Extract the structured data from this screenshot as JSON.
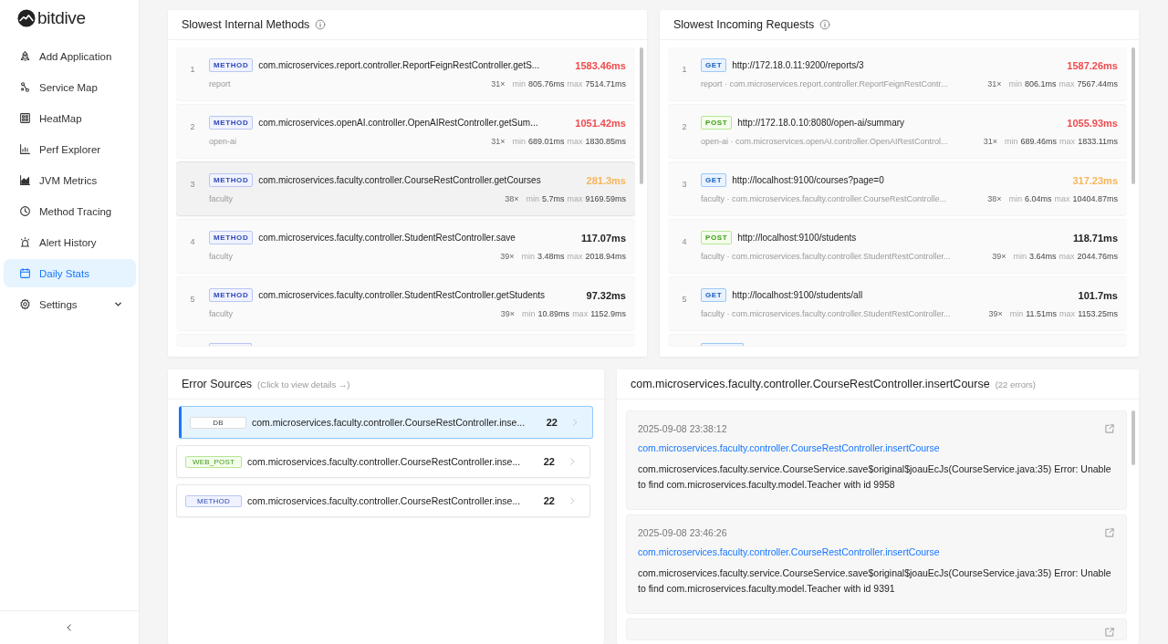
{
  "sidebar": {
    "logo": "bitdive",
    "items": [
      {
        "label": "Add Application",
        "kind": "rocket",
        "selected": false
      },
      {
        "label": "Service Map",
        "kind": "nodes",
        "selected": false
      },
      {
        "label": "HeatMap",
        "kind": "grid",
        "selected": false
      },
      {
        "label": "Perf Explorer",
        "kind": "bars",
        "selected": false
      },
      {
        "label": "JVM Metrics",
        "kind": "area",
        "selected": false
      },
      {
        "label": "Method Tracing",
        "kind": "clock",
        "selected": false
      },
      {
        "label": "Alert History",
        "kind": "alarm",
        "selected": false
      },
      {
        "label": "Daily Stats",
        "kind": "calendar",
        "selected": true
      },
      {
        "label": "Settings",
        "kind": "gear",
        "selected": false,
        "submenu": true
      }
    ]
  },
  "methods_panel": {
    "title": "Slowest Internal Methods",
    "rows": [
      {
        "rank": "1",
        "badge": "METHOD",
        "name": "com.microservices.report.controller.ReportFeignRestController.getS...",
        "service": "report",
        "time": "1583.46ms",
        "color": "#ef4b4f",
        "count": "31×",
        "min_label": "min",
        "min": "805.76ms",
        "max_label": "max",
        "max": "7514.71ms",
        "highlighted": false
      },
      {
        "rank": "2",
        "badge": "METHOD",
        "name": "com.microservices.openAI.controller.OpenAIRestController.getSum...",
        "service": "open-ai",
        "time": "1051.42ms",
        "color": "#ef4b4f",
        "count": "31×",
        "min_label": "min",
        "min": "689.01ms",
        "max_label": "max",
        "max": "1830.85ms",
        "highlighted": false
      },
      {
        "rank": "3",
        "badge": "METHOD",
        "name": "com.microservices.faculty.controller.CourseRestController.getCourses",
        "service": "faculty",
        "time": "281.3ms",
        "color": "#f6b55a",
        "count": "38×",
        "min_label": "min",
        "min": "5.7ms",
        "max_label": "max",
        "max": "9169.59ms",
        "highlighted": true
      },
      {
        "rank": "4",
        "badge": "METHOD",
        "name": "com.microservices.faculty.controller.StudentRestController.save",
        "service": "faculty",
        "time": "117.07ms",
        "color": "#222222",
        "count": "39×",
        "min_label": "min",
        "min": "3.48ms",
        "max_label": "max",
        "max": "2018.94ms",
        "highlighted": false
      },
      {
        "rank": "5",
        "badge": "METHOD",
        "name": "com.microservices.faculty.controller.StudentRestController.getStudents",
        "service": "faculty",
        "time": "97.32ms",
        "color": "#222222",
        "count": "39×",
        "min_label": "min",
        "min": "10.89ms",
        "max_label": "max",
        "max": "1152.9ms",
        "highlighted": false
      }
    ]
  },
  "requests_panel": {
    "title": "Slowest Incoming Requests",
    "rows": [
      {
        "rank": "1",
        "method": "GET",
        "url": "http://172.18.0.11:9200/reports/3",
        "detail": "report · com.microservices.report.controller.ReportFeignRestContr...",
        "time": "1587.26ms",
        "color": "#ef4b4f",
        "count": "31×",
        "min_label": "min",
        "min": "806.1ms",
        "max_label": "max",
        "max": "7567.44ms"
      },
      {
        "rank": "2",
        "method": "POST",
        "url": "http://172.18.0.10:8080/open-ai/summary",
        "detail": "open-ai · com.microservices.openAI.controller.OpenAIRestControl...",
        "time": "1055.93ms",
        "color": "#ef4b4f",
        "count": "31×",
        "min_label": "min",
        "min": "689.46ms",
        "max_label": "max",
        "max": "1833.11ms"
      },
      {
        "rank": "3",
        "method": "GET",
        "url": "http://localhost:9100/courses?page=0",
        "detail": "faculty · com.microservices.faculty.controller.CourseRestControlle...",
        "time": "317.23ms",
        "color": "#f6b55a",
        "count": "38×",
        "min_label": "min",
        "min": "6.04ms",
        "max_label": "max",
        "max": "10404.87ms"
      },
      {
        "rank": "4",
        "method": "POST",
        "url": "http://localhost:9100/students",
        "detail": "faculty · com.microservices.faculty.controller.StudentRestController...",
        "time": "118.71ms",
        "color": "#222222",
        "count": "39×",
        "min_label": "min",
        "min": "3.64ms",
        "max_label": "max",
        "max": "2044.76ms"
      },
      {
        "rank": "5",
        "method": "GET",
        "url": "http://localhost:9100/students/all",
        "detail": "faculty · com.microservices.faculty.controller.StudentRestController...",
        "time": "101.7ms",
        "color": "#222222",
        "count": "39×",
        "min_label": "min",
        "min": "11.51ms",
        "max_label": "max",
        "max": "1153.25ms"
      }
    ]
  },
  "error_sources": {
    "title": "Error Sources",
    "hint": "(Click to view details →)",
    "items": [
      {
        "type": "DB",
        "name": "com.microservices.faculty.controller.CourseRestController.inse...",
        "count": "22",
        "selected": true
      },
      {
        "type": "WEB_POST",
        "name": "com.microservices.faculty.controller.CourseRestController.inse...",
        "count": "22",
        "selected": false
      },
      {
        "type": "METHOD",
        "name": "com.microservices.faculty.controller.CourseRestController.inse...",
        "count": "22",
        "selected": false
      }
    ]
  },
  "error_detail": {
    "title": "com.microservices.faculty.controller.CourseRestController.insertCourse",
    "count": "(22 errors)",
    "entries": [
      {
        "time": "2025-09-08 23:38:12",
        "method": "com.microservices.faculty.controller.CourseRestController.insertCourse",
        "message": "com.microservices.faculty.service.CourseService.save$original$joauEcJs(CourseService.java:35) Error: Unable to find com.microservices.faculty.model.Teacher with id 9958"
      },
      {
        "time": "2025-09-08 23:46:26",
        "method": "com.microservices.faculty.controller.CourseRestController.insertCourse",
        "message": "com.microservices.faculty.service.CourseService.save$original$joauEcJs(CourseService.java:35) Error: Unable to find com.microservices.faculty.model.Teacher with id 9391"
      }
    ]
  }
}
